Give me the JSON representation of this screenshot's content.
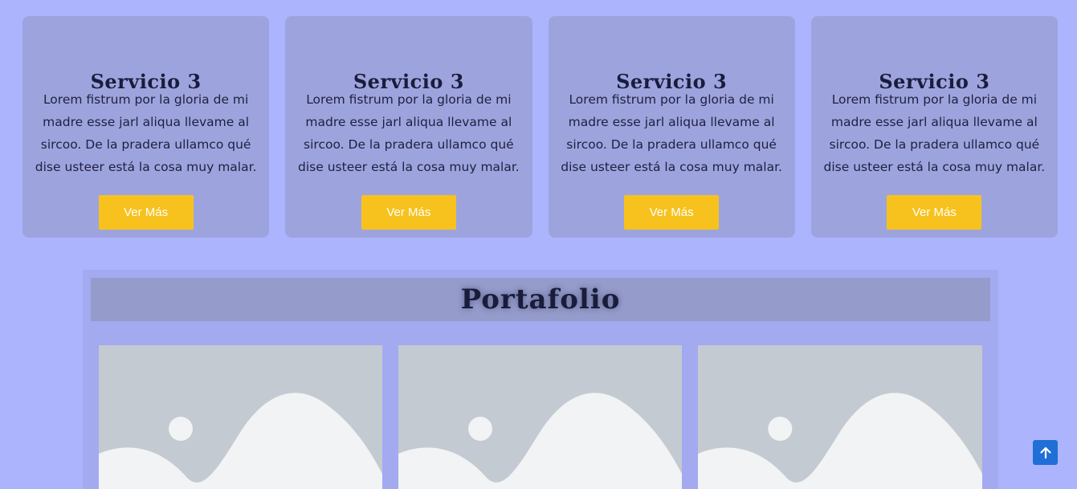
{
  "services": [
    {
      "title": "Servicio 3",
      "text": "Lorem fistrum por la gloria de mi madre esse jarl aliqua llevame al sircoo. De la pradera ullamco qué dise usteer está la cosa muy malar.",
      "button_label": "Ver Más"
    },
    {
      "title": "Servicio 3",
      "text": "Lorem fistrum por la gloria de mi madre esse jarl aliqua llevame al sircoo. De la pradera ullamco qué dise usteer está la cosa muy malar.",
      "button_label": "Ver Más"
    },
    {
      "title": "Servicio 3",
      "text": "Lorem fistrum por la gloria de mi madre esse jarl aliqua llevame al sircoo. De la pradera ullamco qué dise usteer está la cosa muy malar.",
      "button_label": "Ver Más"
    },
    {
      "title": "Servicio 3",
      "text": "Lorem fistrum por la gloria de mi madre esse jarl aliqua llevame al sircoo. De la pradera ullamco qué dise usteer está la cosa muy malar.",
      "button_label": "Ver Más"
    }
  ],
  "portfolio": {
    "title": "Portafolio",
    "items": [
      {
        "icon": "image-placeholder-icon"
      },
      {
        "icon": "image-placeholder-icon"
      },
      {
        "icon": "image-placeholder-icon"
      }
    ]
  },
  "back_to_top": {
    "icon": "chevron-up-icon"
  },
  "colors": {
    "page_background": "#adb4fe",
    "card_background": "#9da4dd",
    "button": "#f7c21e",
    "heading_text": "#1a1c3c",
    "portfolio_background": "#a3aaf0",
    "portfolio_header": "#959ccb",
    "placeholder_background": "#c3cad1",
    "placeholder_shape": "#f1f3f4",
    "back_to_top": "#1f6fd6"
  }
}
